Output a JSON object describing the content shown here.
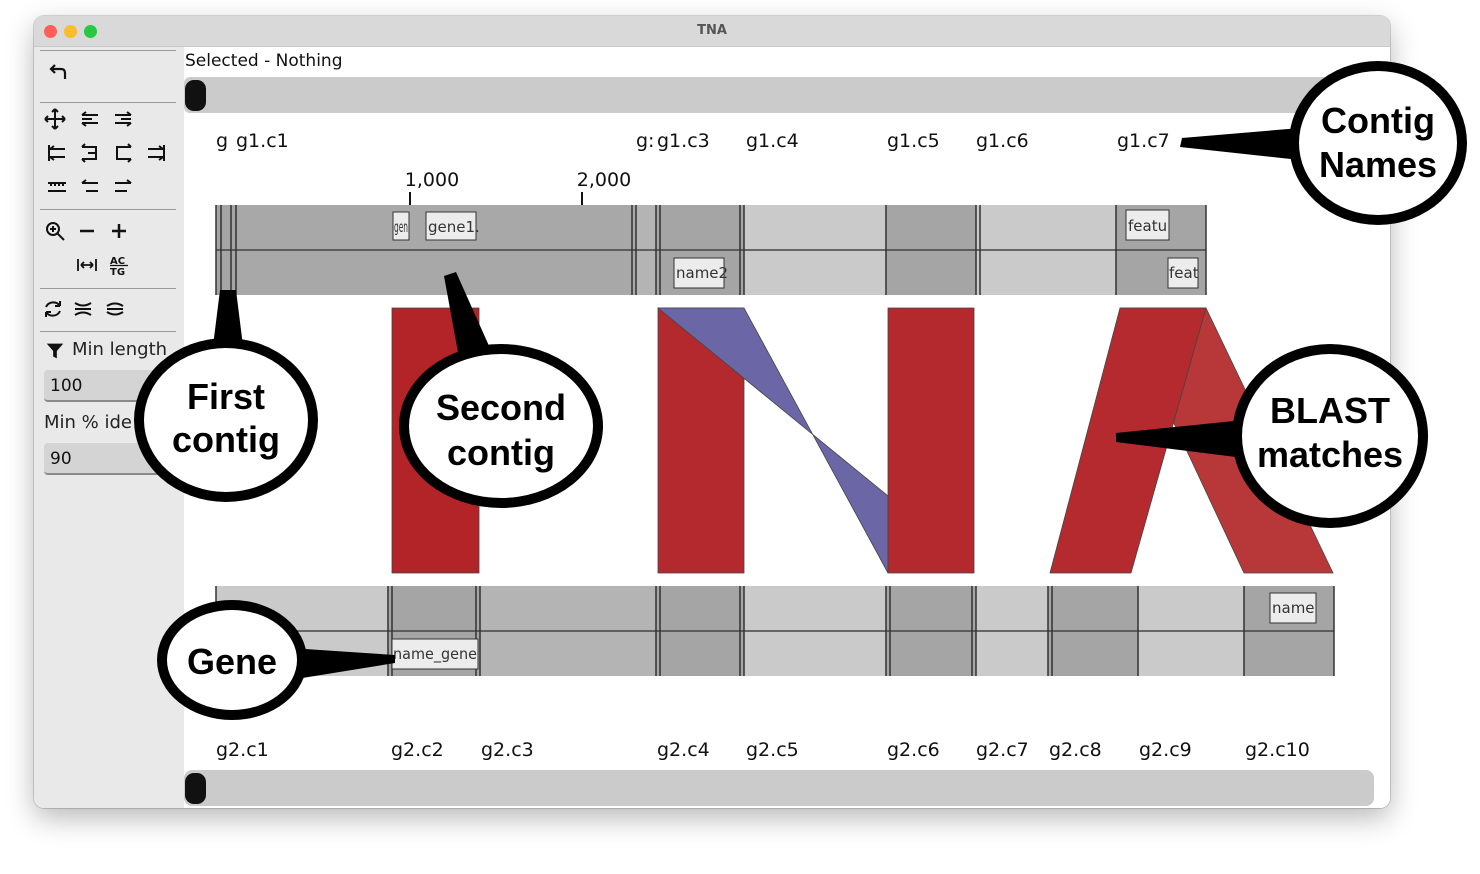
{
  "window": {
    "title": "TNA"
  },
  "status": {
    "selected_text": "Selected - Nothing"
  },
  "toolbar": {
    "min_length_label": "Min length",
    "min_length_value": "100",
    "min_identity_label": "Min % ide",
    "min_identity_value": "90",
    "icons": [
      "undo-icon",
      "move-icon",
      "align-left-icon",
      "align-right-icon",
      "collapse-left-icon",
      "flip-left-icon",
      "flip-right-icon",
      "expand-right-icon",
      "ruler-icon",
      "shift-left-icon",
      "shift-right-icon",
      "zoom-icon",
      "zoom-out-icon",
      "zoom-in-icon",
      "fit-width-icon",
      "text-case-icon",
      "refresh-icon",
      "layers-collapse-icon",
      "layers-expand-icon",
      "filter-icon"
    ]
  },
  "genome1": {
    "contigs": [
      "g",
      "g1.c1",
      "g:",
      "g1.c3",
      "g1.c4",
      "g1.c5",
      "g1.c6",
      "g1.c7"
    ],
    "ruler_ticks": [
      "1,000",
      "2,000"
    ],
    "features": [
      "gen",
      "gene1.",
      "name2",
      "featu",
      "feat"
    ]
  },
  "genome2": {
    "contigs": [
      "g2.c1",
      "g2.c2",
      "g2.c3",
      "g2.c4",
      "g2.c5",
      "g2.c6",
      "g2.c7",
      "g2.c8",
      "g2.c9",
      "g2.c10"
    ],
    "features": [
      "name",
      "name_gene"
    ]
  },
  "annotations": {
    "contig_names": [
      "Contig",
      "Names"
    ],
    "first_contig": [
      "First",
      "contig"
    ],
    "second_contig": [
      "Second",
      "contig"
    ],
    "blast_matches": [
      "BLAST",
      "matches"
    ],
    "gene": [
      "Gene"
    ]
  },
  "colors": {
    "match_red": "#b32a2e",
    "match_blue": "#6b67a6",
    "track_dark": "#a5a5a5",
    "track_mid": "#b4b4b4",
    "track_light": "#cacaca"
  }
}
